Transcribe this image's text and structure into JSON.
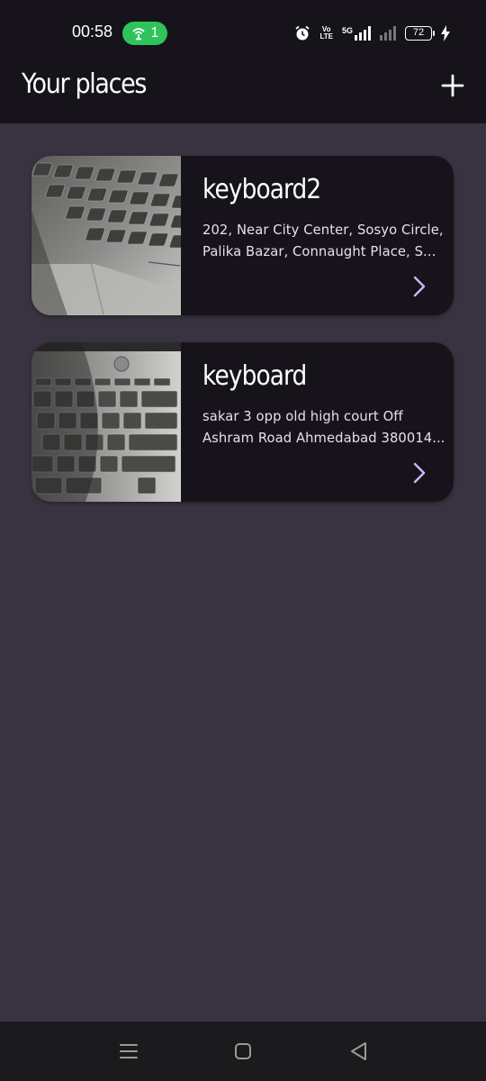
{
  "status_bar": {
    "time": "00:58",
    "hotspot_count": "1",
    "volte_top": "Vo",
    "volte_bottom": "LTE",
    "network_type": "5G",
    "battery_level": "72"
  },
  "header": {
    "title": "Your places",
    "add_icon": "plus-icon"
  },
  "places": [
    {
      "title": "keyboard2",
      "address_line1": "202, Near City Center, Sosyo Circle,",
      "address_line2": "Palika Bazar, Connaught Place, S..."
    },
    {
      "title": "keyboard",
      "address_line1": "sakar 3 opp old high court Off",
      "address_line2": "Ashram Road Ahmedabad 380014..."
    }
  ],
  "nav_bar": {
    "icons": [
      "menu-icon",
      "home-icon",
      "back-icon"
    ]
  },
  "colors": {
    "background": "#393341",
    "surface": "#16131a",
    "accent": "#c9b8ff",
    "hotspot": "#2fc35a"
  }
}
